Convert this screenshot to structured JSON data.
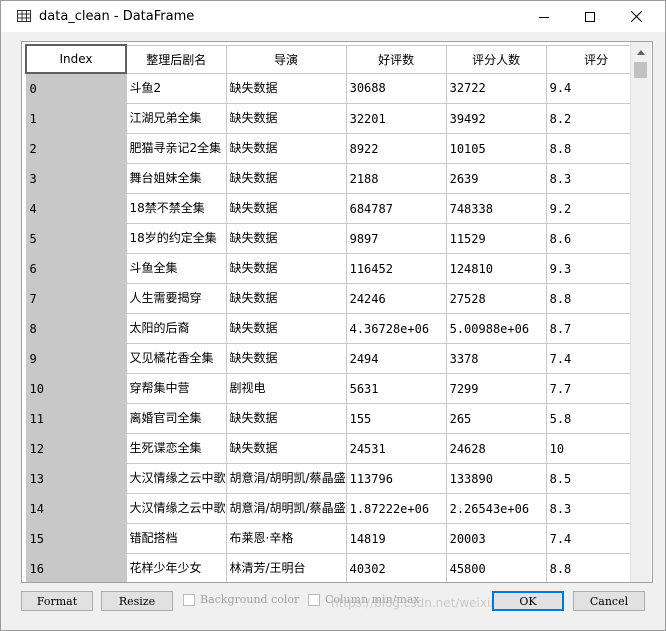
{
  "window": {
    "title": "data_clean - DataFrame",
    "icons": {
      "app": "table-icon",
      "minimize": "minimize-icon",
      "maximize": "maximize-icon",
      "close": "close-icon"
    }
  },
  "grid": {
    "columns": [
      "Index",
      "整理后剧名",
      "导演",
      "好评数",
      "评分人数",
      "评分"
    ],
    "rows": [
      {
        "index": "0",
        "name": "斗鱼2",
        "director": "缺失数据",
        "good": "30688",
        "raters": "32722",
        "score": "9.4"
      },
      {
        "index": "1",
        "name": "江湖兄弟全集",
        "director": "缺失数据",
        "good": "32201",
        "raters": "39492",
        "score": "8.2"
      },
      {
        "index": "2",
        "name": "肥猫寻亲记2全集",
        "director": "缺失数据",
        "good": "8922",
        "raters": "10105",
        "score": "8.8"
      },
      {
        "index": "3",
        "name": "舞台姐妹全集",
        "director": "缺失数据",
        "good": "2188",
        "raters": "2639",
        "score": "8.3"
      },
      {
        "index": "4",
        "name": "18禁不禁全集",
        "director": "缺失数据",
        "good": "684787",
        "raters": "748338",
        "score": "9.2"
      },
      {
        "index": "5",
        "name": "18岁的约定全集",
        "director": "缺失数据",
        "good": "9897",
        "raters": "11529",
        "score": "8.6"
      },
      {
        "index": "6",
        "name": "斗鱼全集",
        "director": "缺失数据",
        "good": "116452",
        "raters": "124810",
        "score": "9.3"
      },
      {
        "index": "7",
        "name": "人生需要揭穿",
        "director": "缺失数据",
        "good": "24246",
        "raters": "27528",
        "score": "8.8"
      },
      {
        "index": "8",
        "name": "太阳的后裔",
        "director": "缺失数据",
        "good": "4.36728e+06",
        "raters": "5.00988e+06",
        "score": "8.7"
      },
      {
        "index": "9",
        "name": "又见橘花香全集",
        "director": "缺失数据",
        "good": "2494",
        "raters": "3378",
        "score": "7.4"
      },
      {
        "index": "10",
        "name": "穿帮集中营",
        "director": "剧视电",
        "good": "5631",
        "raters": "7299",
        "score": "7.7"
      },
      {
        "index": "11",
        "name": "离婚官司全集",
        "director": "缺失数据",
        "good": "155",
        "raters": "265",
        "score": "5.8"
      },
      {
        "index": "12",
        "name": "生死谍恋全集",
        "director": "缺失数据",
        "good": "24531",
        "raters": "24628",
        "score": "10"
      },
      {
        "index": "13",
        "name": "大汉情缘之云中歌",
        "director": "胡意涓/胡明凯/蔡晶盛",
        "good": "113796",
        "raters": "133890",
        "score": "8.5"
      },
      {
        "index": "14",
        "name": "大汉情缘之云中歌",
        "director": "胡意涓/胡明凯/蔡晶盛",
        "good": "1.87222e+06",
        "raters": "2.26543e+06",
        "score": "8.3"
      },
      {
        "index": "15",
        "name": "错配搭档",
        "director": "布莱恩·辛格",
        "good": "14819",
        "raters": "20003",
        "score": "7.4"
      },
      {
        "index": "16",
        "name": "花样少年少女",
        "director": "林清芳/王明台",
        "good": "40302",
        "raters": "45800",
        "score": "8.8"
      }
    ]
  },
  "bottom": {
    "format_label": "Format",
    "resize_label": "Resize",
    "bg_color_label": "Background color",
    "col_minmax_label": "Column min/max",
    "ok_label": "OK",
    "cancel_label": "Cancel",
    "watermark": "https://blog.csdn.net/weixin_43301887"
  }
}
